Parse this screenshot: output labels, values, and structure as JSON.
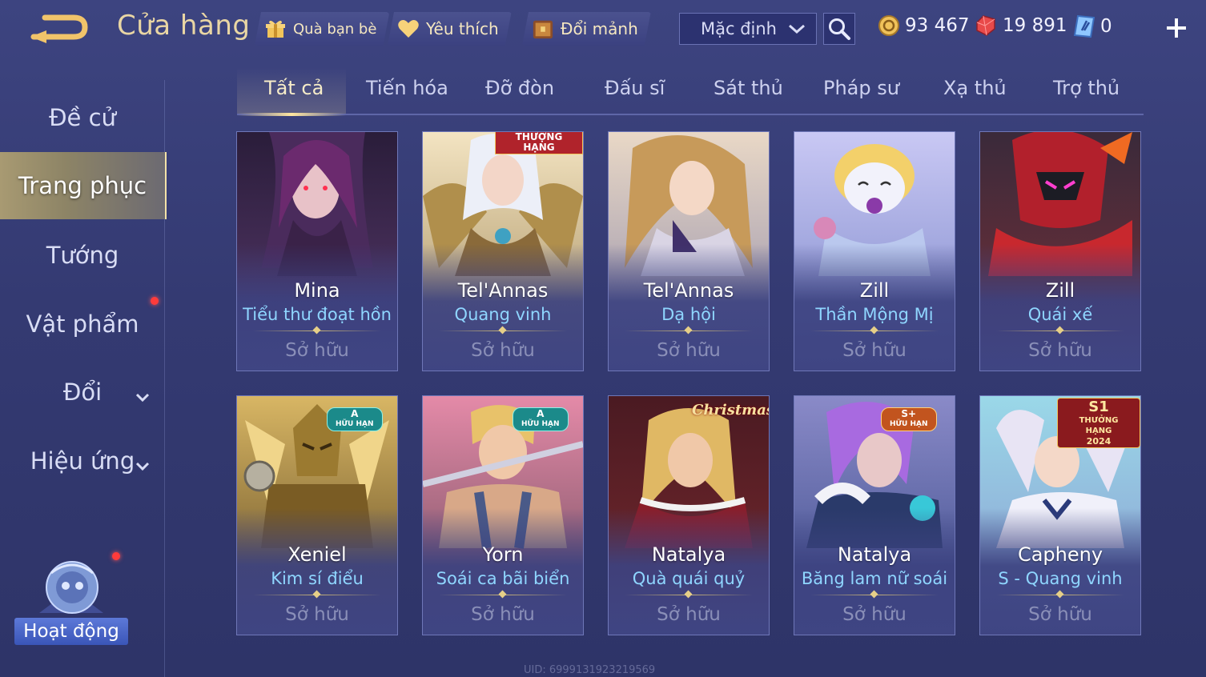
{
  "header": {
    "title": "Cửa hàng",
    "buttons": [
      {
        "label": "Quà bạn bè",
        "icon": "gift-icon"
      },
      {
        "label": "Yêu thích",
        "icon": "heart-icon"
      },
      {
        "label": "Đổi mảnh",
        "icon": "chest-icon"
      }
    ],
    "sort": {
      "value": "Mặc định"
    },
    "currencies": [
      {
        "value": "93 467",
        "icon": "gold-coin-icon"
      },
      {
        "value": "19 891",
        "icon": "ruby-gem-icon"
      },
      {
        "value": "0",
        "icon": "voucher-icon"
      }
    ]
  },
  "sidebar": {
    "items": [
      {
        "label": "Đề cử"
      },
      {
        "label": "Trang phục"
      },
      {
        "label": "Tướng"
      },
      {
        "label": "Vật phẩm"
      },
      {
        "label": "Đổi"
      },
      {
        "label": "Hiệu ứng"
      }
    ],
    "activity_label": "Hoạt động"
  },
  "tabs": [
    "Tất cả",
    "Tiến hóa",
    "Đỡ đòn",
    "Đấu sĩ",
    "Sát thủ",
    "Pháp sư",
    "Xạ thủ",
    "Trợ thủ"
  ],
  "cards": [
    {
      "hero": "Mina",
      "skin": "Tiểu thư đoạt hồn",
      "status": "Sở hữu",
      "badge": ""
    },
    {
      "hero": "Tel'Annas",
      "skin": "Quang vinh",
      "status": "Sở hữu",
      "badge": "THƯỢNG HẠNG"
    },
    {
      "hero": "Tel'Annas",
      "skin": "Dạ hội",
      "status": "Sở hữu",
      "badge": ""
    },
    {
      "hero": "Zill",
      "skin": "Thần Mộng Mị",
      "status": "Sở hữu",
      "badge": ""
    },
    {
      "hero": "Zill",
      "skin": "Quái xế",
      "status": "Sở hữu",
      "badge": ""
    },
    {
      "hero": "Xeniel",
      "skin": "Kim sí điểu",
      "status": "Sở hữu",
      "badge": "A",
      "badge_sub": "HỮU HẠN"
    },
    {
      "hero": "Yorn",
      "skin": "Soái ca bãi biển",
      "status": "Sở hữu",
      "badge": "A",
      "badge_sub": "HỮU HẠN"
    },
    {
      "hero": "Natalya",
      "skin": "Quà quái quỷ",
      "status": "Sở hữu",
      "badge": "Christmas"
    },
    {
      "hero": "Natalya",
      "skin": "Băng lam nữ soái",
      "status": "Sở hữu",
      "badge": "S+",
      "badge_sub": "HỮU HẠN"
    },
    {
      "hero": "Capheny",
      "skin": "S - Quang vinh",
      "status": "Sở hữu",
      "badge": "S1",
      "badge_sub": "THƯỞNG HẠNG",
      "badge_year": "2024"
    }
  ],
  "footer": {
    "uid": "UID: 6999131923219569"
  },
  "colors": {
    "accent_gold": "#e9d6a4",
    "skin_name": "#8fd6ff",
    "background": "#3d4480"
  }
}
